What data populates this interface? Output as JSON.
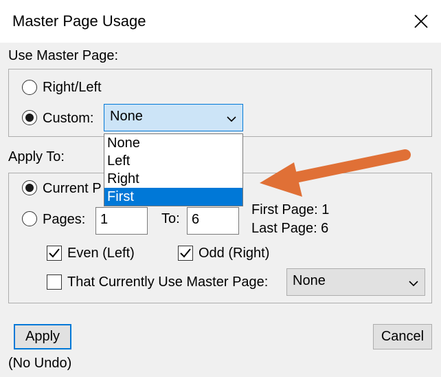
{
  "window": {
    "title": "Master Page Usage",
    "close_icon": "close-icon"
  },
  "use_master_page": {
    "label": "Use Master Page:",
    "right_left_label": "Right/Left",
    "custom_label": "Custom:",
    "custom_value": "None",
    "options": [
      "None",
      "Left",
      "Right",
      "First"
    ],
    "highlighted_option": "First"
  },
  "apply_to": {
    "label": "Apply To:",
    "current_page_label": "Current P",
    "pages_label": "Pages:",
    "pages_from": "1",
    "to_label": "To:",
    "pages_to": "6",
    "first_page_text": "First Page: 1",
    "last_page_text": "Last Page: 6",
    "even_label": "Even  (Left)",
    "odd_label": "Odd  (Right)",
    "currently_use_label": "That Currently Use Master Page:",
    "currently_use_value": "None"
  },
  "footer": {
    "apply_label": "Apply",
    "no_undo_label": "(No Undo)",
    "cancel_label": "Cancel"
  },
  "annotation": {
    "arrow_color": "#e07036"
  }
}
